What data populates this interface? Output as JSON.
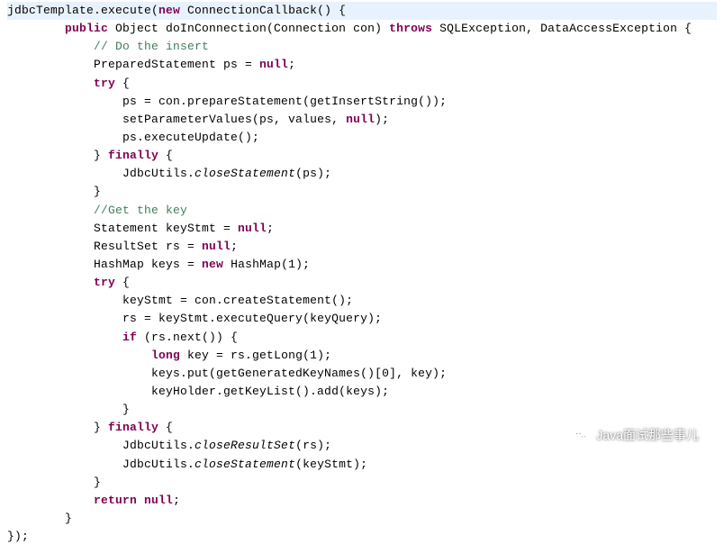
{
  "code": {
    "lines": [
      {
        "highlight": true,
        "tokens": [
          {
            "t": "jdbcTemplate.execute("
          },
          {
            "t": "new",
            "cls": "kw"
          },
          {
            "t": " ConnectionCallback() {"
          }
        ]
      },
      {
        "indent": 2,
        "tokens": [
          {
            "t": "public",
            "cls": "kw"
          },
          {
            "t": " Object doInConnection(Connection con) "
          },
          {
            "t": "throws",
            "cls": "kw"
          },
          {
            "t": " SQLException, DataAccessException {"
          }
        ]
      },
      {
        "indent": 3,
        "tokens": [
          {
            "t": "// Do the insert",
            "cls": "comment"
          }
        ]
      },
      {
        "indent": 3,
        "tokens": [
          {
            "t": "PreparedStatement ps = "
          },
          {
            "t": "null",
            "cls": "kw"
          },
          {
            "t": ";"
          }
        ]
      },
      {
        "indent": 3,
        "tokens": [
          {
            "t": "try",
            "cls": "kw"
          },
          {
            "t": " {"
          }
        ]
      },
      {
        "indent": 4,
        "tokens": [
          {
            "t": "ps = con.prepareStatement(getInsertString());"
          }
        ]
      },
      {
        "indent": 4,
        "tokens": [
          {
            "t": "setParameterValues(ps, values, "
          },
          {
            "t": "null",
            "cls": "kw"
          },
          {
            "t": ");"
          }
        ]
      },
      {
        "indent": 4,
        "tokens": [
          {
            "t": "ps.executeUpdate();"
          }
        ]
      },
      {
        "indent": 3,
        "tokens": [
          {
            "t": "} "
          },
          {
            "t": "finally",
            "cls": "kw"
          },
          {
            "t": " {"
          }
        ]
      },
      {
        "indent": 4,
        "tokens": [
          {
            "t": "JdbcUtils."
          },
          {
            "t": "closeStatement",
            "cls": "static-call"
          },
          {
            "t": "(ps);"
          }
        ]
      },
      {
        "indent": 3,
        "tokens": [
          {
            "t": "}"
          }
        ]
      },
      {
        "indent": 3,
        "tokens": [
          {
            "t": "//Get the key",
            "cls": "comment"
          }
        ]
      },
      {
        "indent": 3,
        "tokens": [
          {
            "t": "Statement keyStmt = "
          },
          {
            "t": "null",
            "cls": "kw"
          },
          {
            "t": ";"
          }
        ]
      },
      {
        "indent": 3,
        "tokens": [
          {
            "t": "ResultSet rs = "
          },
          {
            "t": "null",
            "cls": "kw"
          },
          {
            "t": ";"
          }
        ]
      },
      {
        "indent": 3,
        "tokens": [
          {
            "t": "HashMap keys = "
          },
          {
            "t": "new",
            "cls": "kw"
          },
          {
            "t": " HashMap(1);"
          }
        ]
      },
      {
        "indent": 3,
        "tokens": [
          {
            "t": "try",
            "cls": "kw"
          },
          {
            "t": " {"
          }
        ]
      },
      {
        "indent": 4,
        "tokens": [
          {
            "t": "keyStmt = con.createStatement();"
          }
        ]
      },
      {
        "indent": 4,
        "tokens": [
          {
            "t": "rs = keyStmt.executeQuery(keyQuery);"
          }
        ]
      },
      {
        "indent": 4,
        "tokens": [
          {
            "t": "if",
            "cls": "kw"
          },
          {
            "t": " (rs.next()) {"
          }
        ]
      },
      {
        "indent": 5,
        "tokens": [
          {
            "t": "long",
            "cls": "kw"
          },
          {
            "t": " key = rs.getLong(1);"
          }
        ]
      },
      {
        "indent": 5,
        "tokens": [
          {
            "t": "keys.put(getGeneratedKeyNames()[0], key);"
          }
        ]
      },
      {
        "indent": 5,
        "tokens": [
          {
            "t": "keyHolder.getKeyList().add(keys);"
          }
        ]
      },
      {
        "indent": 4,
        "tokens": [
          {
            "t": "}"
          }
        ]
      },
      {
        "indent": 3,
        "tokens": [
          {
            "t": "} "
          },
          {
            "t": "finally",
            "cls": "kw"
          },
          {
            "t": " {"
          }
        ]
      },
      {
        "indent": 4,
        "tokens": [
          {
            "t": "JdbcUtils."
          },
          {
            "t": "closeResultSet",
            "cls": "static-call"
          },
          {
            "t": "(rs);"
          }
        ]
      },
      {
        "indent": 4,
        "tokens": [
          {
            "t": "JdbcUtils."
          },
          {
            "t": "closeStatement",
            "cls": "static-call"
          },
          {
            "t": "(keyStmt);"
          }
        ]
      },
      {
        "indent": 3,
        "tokens": [
          {
            "t": "}"
          }
        ]
      },
      {
        "indent": 3,
        "tokens": [
          {
            "t": "return",
            "cls": "kw"
          },
          {
            "t": " "
          },
          {
            "t": "null",
            "cls": "kw"
          },
          {
            "t": ";"
          }
        ]
      },
      {
        "indent": 2,
        "tokens": [
          {
            "t": "}"
          }
        ]
      },
      {
        "indent": 0,
        "tokens": [
          {
            "t": "});"
          }
        ]
      }
    ]
  },
  "watermark": {
    "text": "Java面试那些事儿"
  }
}
